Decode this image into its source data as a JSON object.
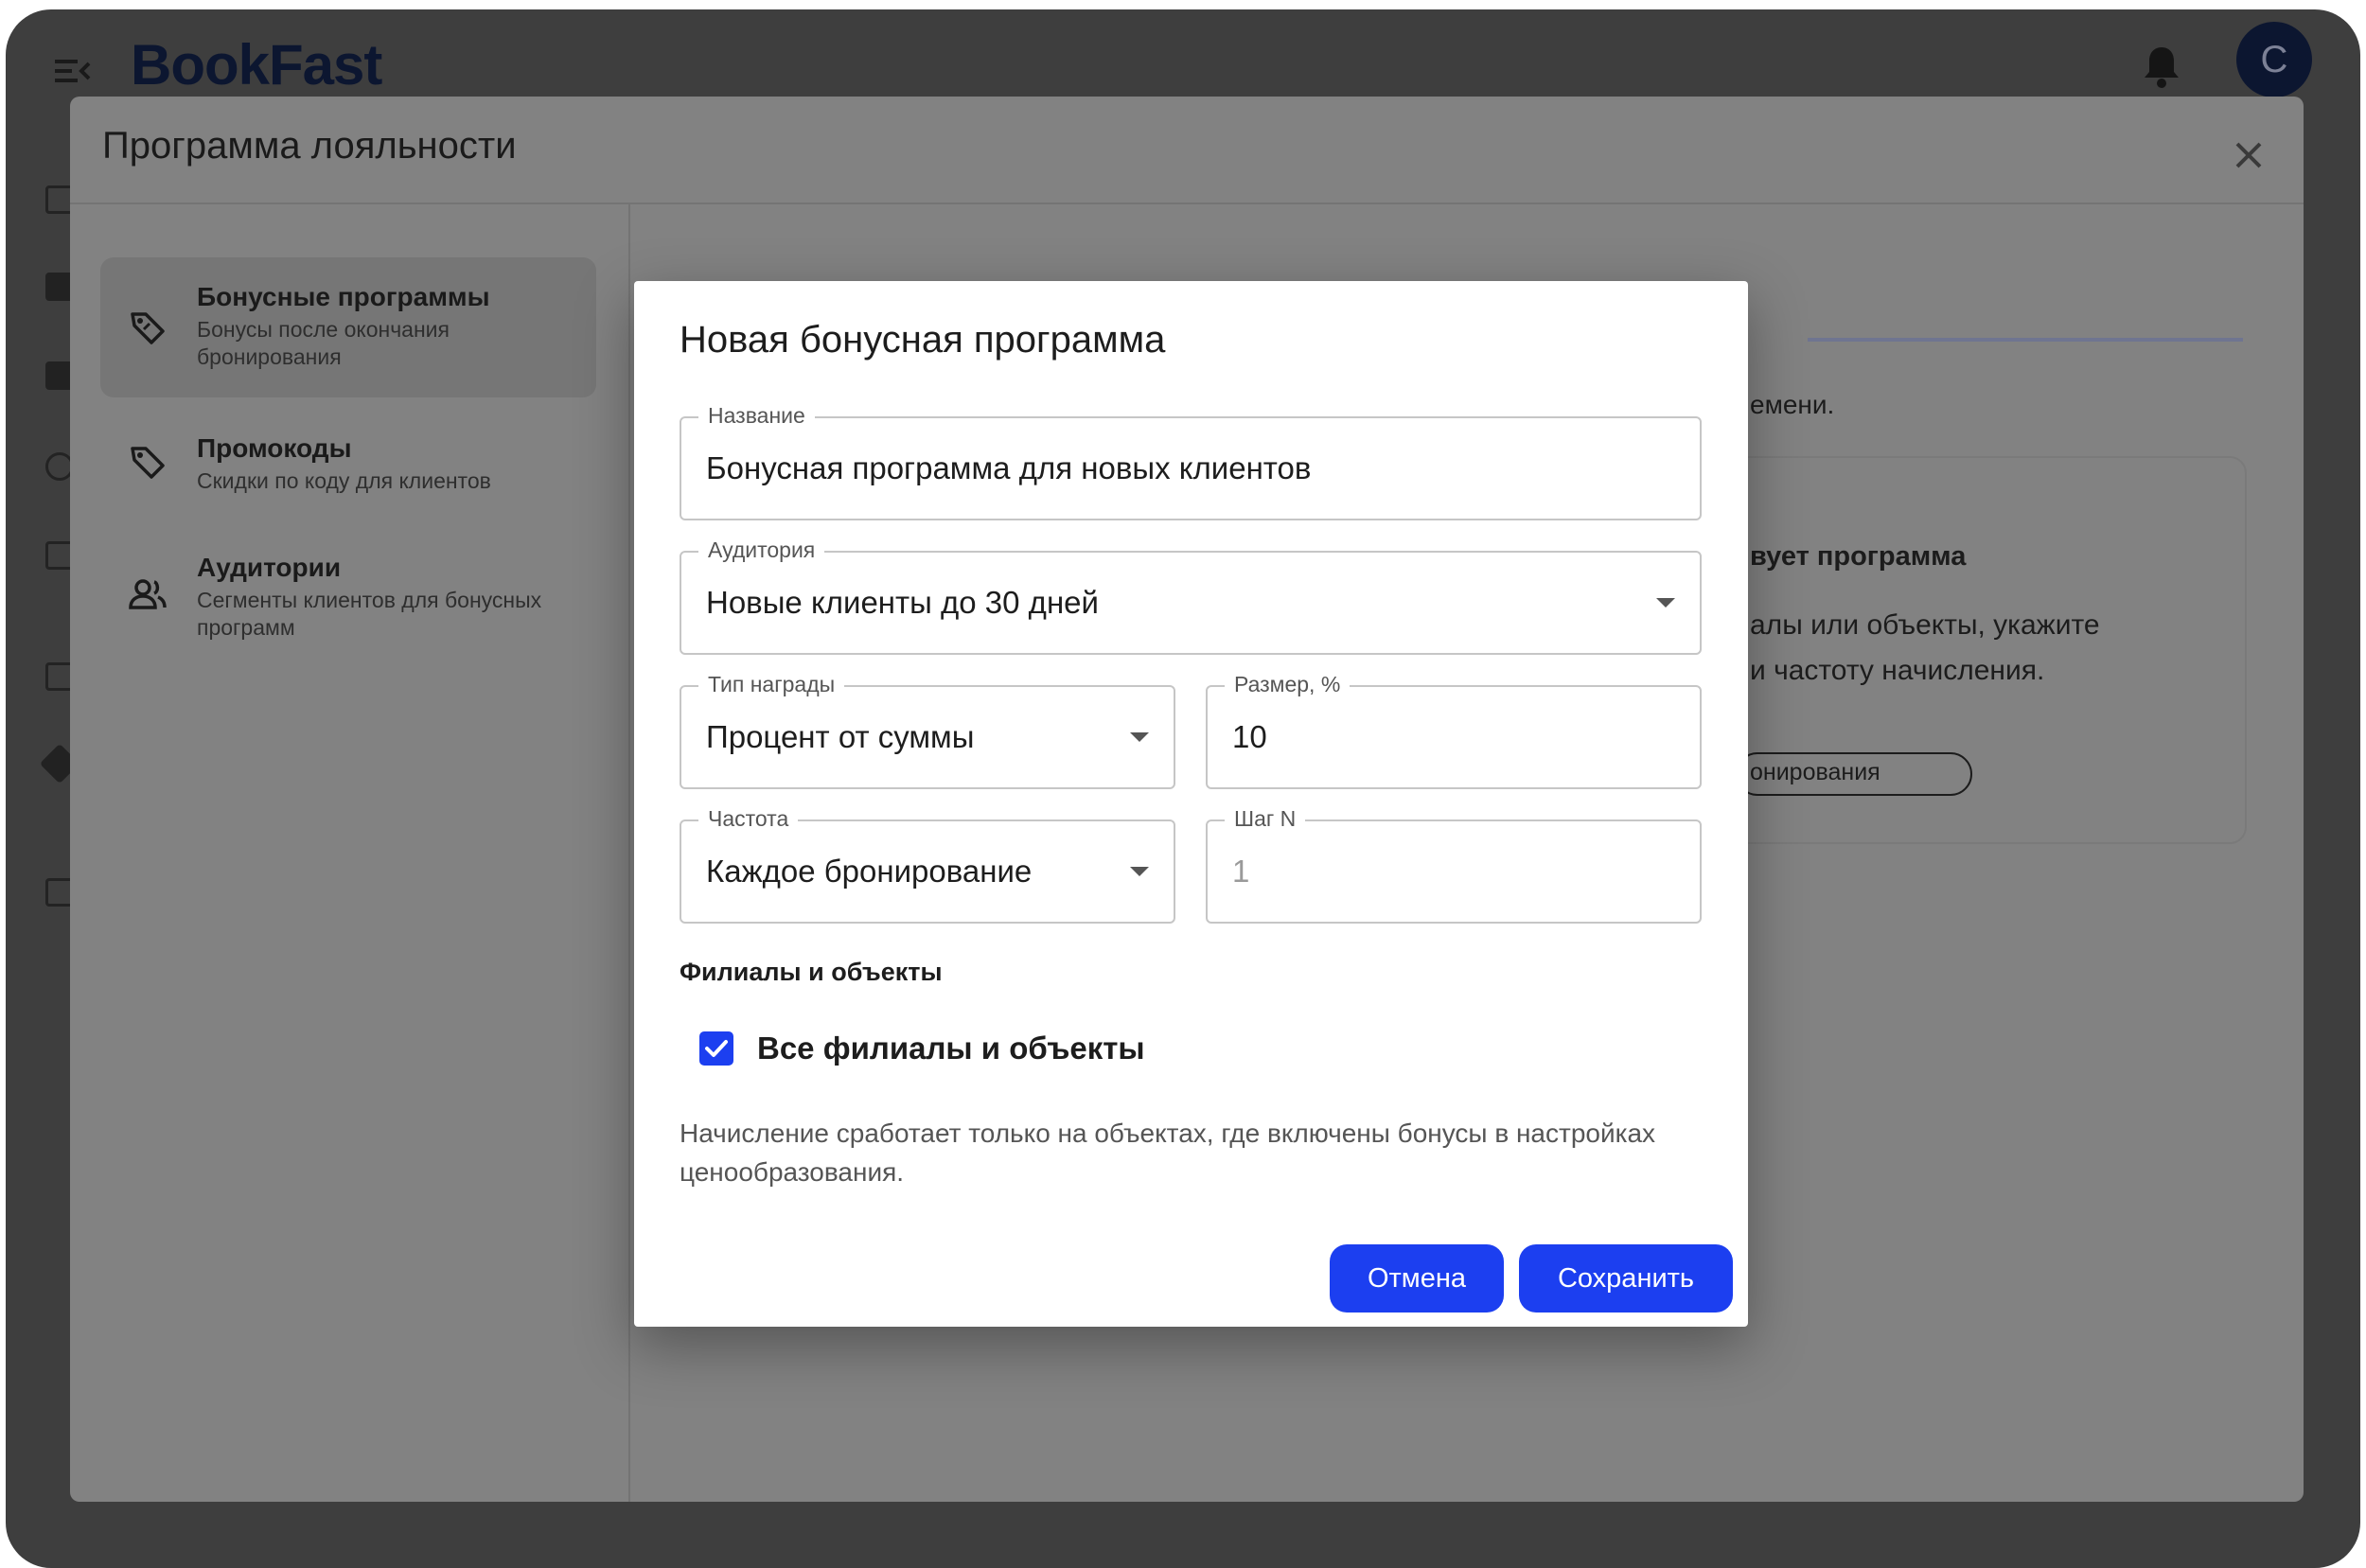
{
  "app": {
    "logo": "BookFast",
    "avatar_initial": "C"
  },
  "loyalty": {
    "title": "Программа лояльности",
    "sidebar": [
      {
        "title": "Бонусные программы",
        "subtitle": "Бонусы после окончания бронирования"
      },
      {
        "title": "Промокоды",
        "subtitle": "Скидки по коду для клиентов"
      },
      {
        "title": "Аудитории",
        "subtitle": "Сегменты клиентов для бонусных программ"
      }
    ],
    "background_fragments": {
      "line1": "емени.",
      "heading": "вует программа",
      "line2": "алы или объекты, укажите",
      "line3": "и частоту начисления.",
      "chip": "онирования"
    }
  },
  "modal": {
    "title": "Новая бонусная программа",
    "name": {
      "label": "Название",
      "value": "Бонусная программа для новых клиентов"
    },
    "audience": {
      "label": "Аудитория",
      "value": "Новые клиенты до 30 дней"
    },
    "reward_type": {
      "label": "Тип награды",
      "value": "Процент от суммы"
    },
    "size": {
      "label": "Размер, %",
      "value": "10"
    },
    "frequency": {
      "label": "Частота",
      "value": "Каждое бронирование"
    },
    "step": {
      "label": "Шаг N",
      "value": "1"
    },
    "branches": {
      "section_title": "Филиалы и объекты",
      "all_label": "Все филиалы и объекты",
      "all_checked": true
    },
    "hint": "Начисление сработает только на объектах, где включены бонусы в настройках ценообразования.",
    "cancel_label": "Отмена",
    "save_label": "Сохранить"
  },
  "colors": {
    "accent": "#1c3ff0",
    "overlay": "#3e3e3e",
    "brand_dark": "#0c1630"
  }
}
